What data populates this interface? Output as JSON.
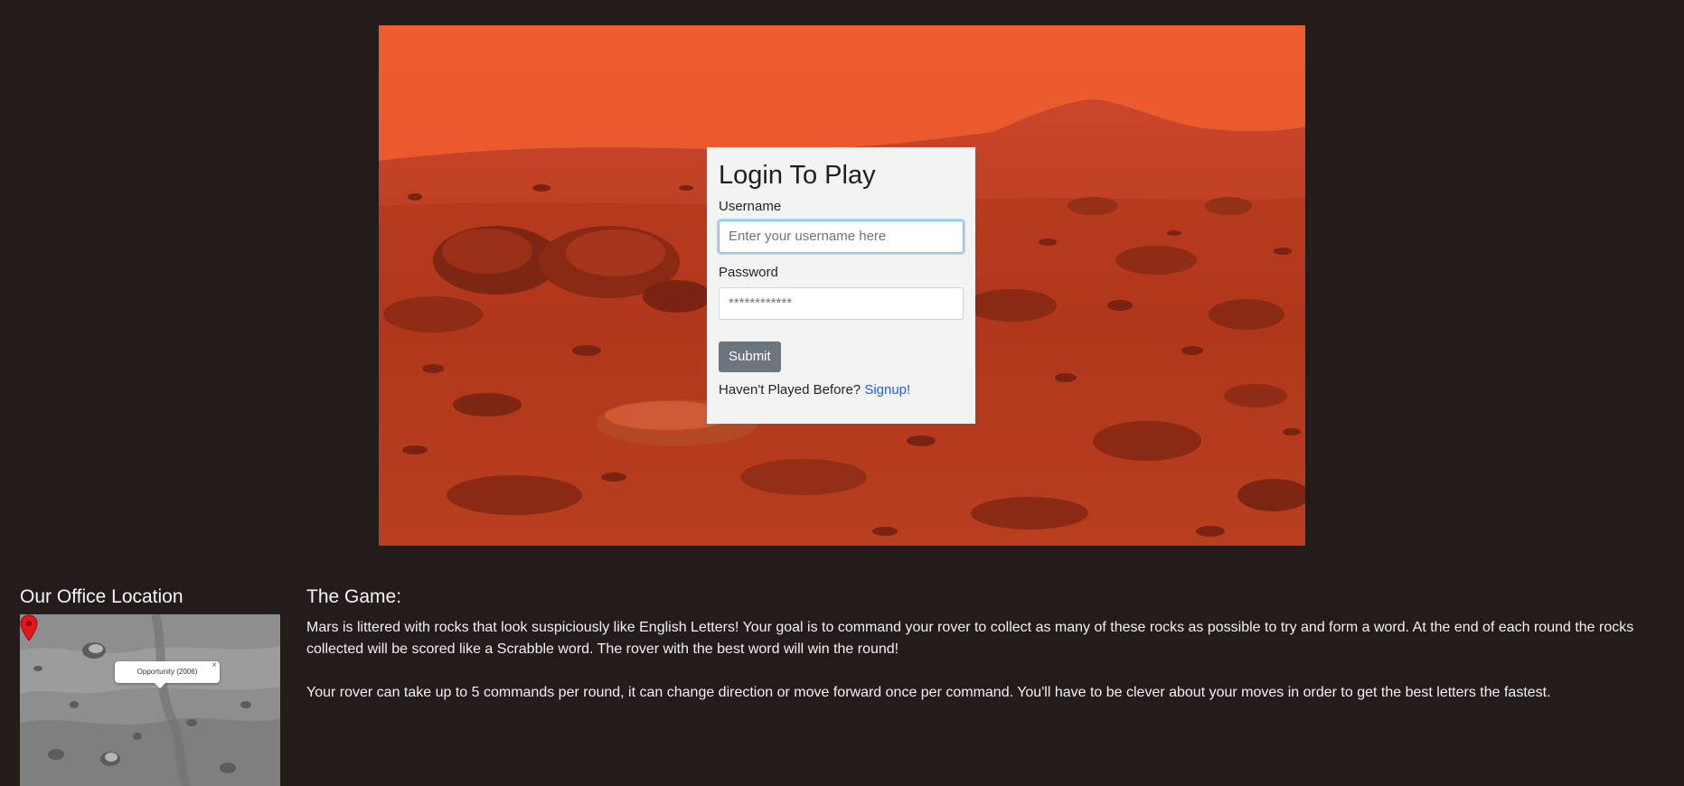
{
  "login": {
    "title": "Login To Play",
    "username_label": "Username",
    "username_placeholder": "Enter your username here",
    "password_label": "Password",
    "password_placeholder": "************",
    "submit_label": "Submit",
    "signup_prompt": "Haven't Played Before?",
    "signup_link": "Signup!"
  },
  "office": {
    "heading": "Our Office Location",
    "popup_text": "Opportunity (2006)",
    "popup_close": "×",
    "pin_color": "#e8161b"
  },
  "game": {
    "heading": "The Game:",
    "paragraph1": "Mars is littered with rocks that look suspiciously like English Letters! Your goal is to command your rover to collect as many of these rocks as possible to try and form a word. At the end of each round the rocks collected will be scored like a Scrabble word. The rover with the best word will win the round!",
    "paragraph2": "Your rover can take up to 5 commands per round, it can change direction or move forward once per command. You'll have to be clever about your moves in order to get the best letters the fastest."
  },
  "colors": {
    "page_background": "#231c1b",
    "mars_sky": "#e85a30",
    "mars_ground": "#b8381c",
    "link": "#1a62d8",
    "button": "#6c757d"
  }
}
